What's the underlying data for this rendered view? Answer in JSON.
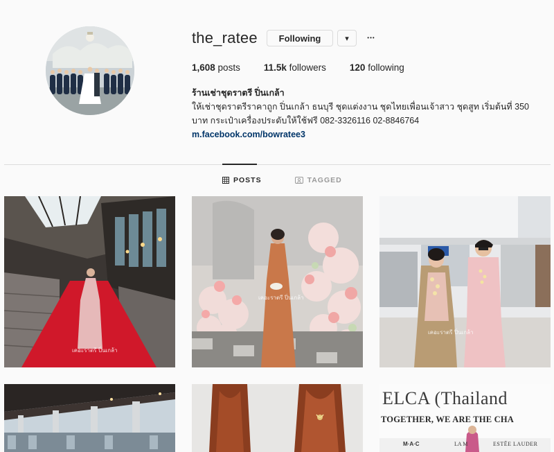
{
  "profile": {
    "username": "the_ratee",
    "follow_label": "Following",
    "caret_symbol": "▾",
    "more_symbol": "•••",
    "stats": {
      "posts_count": "1,608",
      "posts_label": " posts",
      "followers_count": "11.5k",
      "followers_label": " followers",
      "following_count": "120",
      "following_label": " following"
    },
    "bio": {
      "name": "ร้านเช่าชุดราตรี ปิ่นเกล้า",
      "description": "ให้เช่าชุดราตรีราคาถูก ปิ่นเกล้า ธนบุรี ชุดแต่งงาน ชุดไทยเพื่อนเจ้าสาว ชุดสูท เริ่มต้นที่ 350 บาท กระเป๋าเครื่องประดับให้ใช้ฟรี 082-3326116 02-8846764",
      "link": "m.facebook.com/bowratee3"
    }
  },
  "tabs": [
    {
      "label": "POSTS",
      "icon": "grid-icon",
      "active": true
    },
    {
      "label": "TAGGED",
      "icon": "tag-icon",
      "active": false
    }
  ],
  "posts": [
    {
      "id": "post-1",
      "watermark": "เคอะราตรี ปิ่นเกล้า"
    },
    {
      "id": "post-2",
      "watermark": "เคอะราตรี ปิ่นเกล้า"
    },
    {
      "id": "post-3",
      "watermark": "เคอะราตรี ปิ่นเกล้า"
    },
    {
      "id": "post-4"
    },
    {
      "id": "post-5"
    },
    {
      "id": "post-6",
      "text_line1": "ELCA (Thailand",
      "text_line2": "TOGETHER, WE ARE THE CHA",
      "brands": [
        "M·A·C",
        "LA M",
        "ESTĒE LAUDER"
      ]
    }
  ],
  "colors": {
    "text": "#262626",
    "link": "#003569",
    "border": "#dbdbdb",
    "muted": "#999999"
  }
}
